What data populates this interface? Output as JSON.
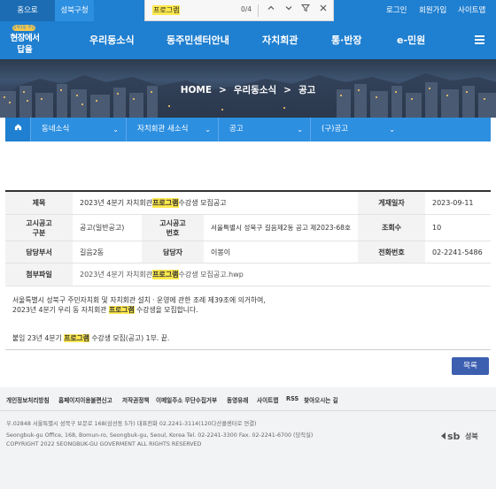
{
  "topbar": {
    "home": "홈으로",
    "gu": "성북구청",
    "login": "로그인",
    "join": "회원가입",
    "sitemap": "사이트맵"
  },
  "findbar": {
    "query": "프로그램",
    "count": "0/4"
  },
  "logo": {
    "top": "장위1동 주민센터",
    "line1": "현장에서",
    "line2": "답을"
  },
  "nav": {
    "items": [
      "우리동소식",
      "동주민센터안내",
      "자치회관",
      "통·반장",
      "e-민원"
    ]
  },
  "breadcrumb": [
    "HOME",
    "우리동소식",
    "공고"
  ],
  "subnav": {
    "items": [
      "동네소식",
      "자치회관 새소식",
      "공고",
      "(구)공고"
    ]
  },
  "detail": {
    "title_label": "제목",
    "title_pre": "2023년 4분기 자치회관 ",
    "title_hl": "프로그램",
    "title_post": " 수강생 모집공고",
    "date_label": "게재일자",
    "date": "2023-09-11",
    "type_label": "고시공고\n구분",
    "type": "공고(일반공고)",
    "num_label": "고시공고\n번호",
    "num": "서울특별시 성북구 길음제2동 공고 제2023-68호",
    "views_label": "조회수",
    "views": "10",
    "dept_label": "담당부서",
    "dept": "길음2동",
    "manager_label": "담당자",
    "manager": "이봉이",
    "phone_label": "전화번호",
    "phone": "02-2241-5486",
    "attach_label": "첨부파일",
    "attach_pre": "2023년 4분기 자치회관 ",
    "attach_hl": "프로그램",
    "attach_post": " 수강생 모집공고.hwp"
  },
  "content": {
    "line1": "서울특별시 성북구 주민자치회 및 자치회관 설치ㆍ운영에 관한 조례 제39조에 의거하여,",
    "line2_pre": "2023년 4분기 우리 동 자치회관 ",
    "line2_hl": "프로그램",
    "line2_post": " 수강생을 모집합니다.",
    "line3_pre": "붙임 23년 4분기 ",
    "line3_hl": "프로그램",
    "line3_post": " 수강생 모집(공고) 1부. 끝."
  },
  "list_button": "목록",
  "footer": {
    "links": [
      "개인정보처리방침",
      "홈페이지이용불편신고",
      "저작권정책",
      "이메일주소 무단수집거부",
      "동영유래",
      "사이트맵",
      "RSS",
      "찾아오시는 길"
    ],
    "addr_ko": "우.02848 서울특별시 성북구 보문로 168(삼선동 5가) 대표전화 02.2241-3114(120다산콜센터로 연결)",
    "addr_en": "Seongbuk-gu Office, 168, Bomun-ro, Seongbuk-gu, Seoul, Korea Tel. 02-2241-3300 Fax. 02-2241-6700 (당직실)",
    "copyright": "COPYRIGHT 2022 SEONGBUK-GU GOVERMENT ALL RIGHTS RESERVED",
    "brand": "성북"
  }
}
